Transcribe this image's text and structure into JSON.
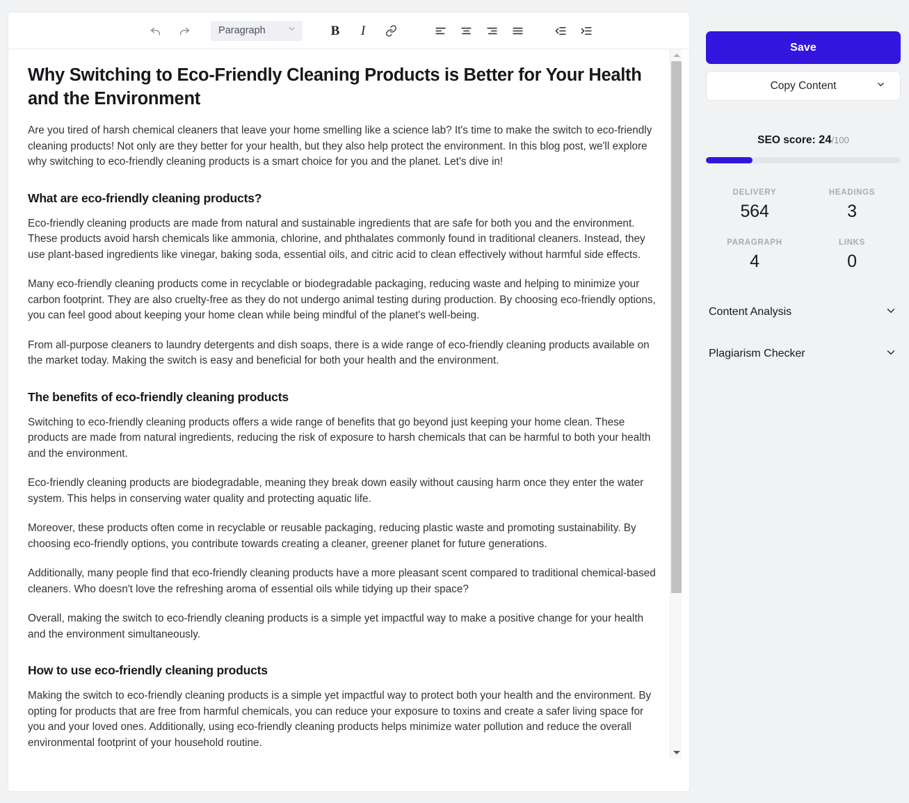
{
  "toolbar": {
    "undo_label": "undo-icon",
    "redo_label": "redo-icon",
    "block_format": "Paragraph",
    "bold_label": "B",
    "italic_label": "I",
    "link_label": "link-icon",
    "align_left_label": "align-left-icon",
    "align_center_label": "align-center-icon",
    "align_right_label": "align-right-icon",
    "align_justify_label": "align-justify-icon",
    "outdent_label": "outdent-icon",
    "indent_label": "indent-icon"
  },
  "document": {
    "title": "Why Switching to Eco-Friendly Cleaning Products is Better for Your Health and the Environment",
    "intro": "Are you tired of harsh chemical cleaners that leave your home smelling like a science lab? It's time to make the switch to eco-friendly cleaning products! Not only are they better for your health, but they also help protect the environment. In this blog post, we'll explore why switching to eco-friendly cleaning products is a smart choice for you and the planet. Let's dive in!",
    "h2_1": "What are eco-friendly cleaning products?",
    "p1": "Eco-friendly cleaning products are made from natural and sustainable ingredients that are safe for both you and the environment. These products avoid harsh chemicals like ammonia, chlorine, and phthalates commonly found in traditional cleaners. Instead, they use plant-based ingredients like vinegar, baking soda, essential oils, and citric acid to clean effectively without harmful side effects.",
    "p2": "Many eco-friendly cleaning products come in recyclable or biodegradable packaging, reducing waste and helping to minimize your carbon footprint. They are also cruelty-free as they do not undergo animal testing during production. By choosing eco-friendly options, you can feel good about keeping your home clean while being mindful of the planet's well-being.",
    "p3": "From all-purpose cleaners to laundry detergents and dish soaps, there is a wide range of eco-friendly cleaning products available on the market today. Making the switch is easy and beneficial for both your health and the environment.",
    "h2_2": "The benefits of eco-friendly cleaning products",
    "p4": "Switching to eco-friendly cleaning products offers a wide range of benefits that go beyond just keeping your home clean. These products are made from natural ingredients, reducing the risk of exposure to harsh chemicals that can be harmful to both your health and the environment.",
    "p5": "Eco-friendly cleaning products are biodegradable, meaning they break down easily without causing harm once they enter the water system. This helps in conserving water quality and protecting aquatic life.",
    "p6": "Moreover, these products often come in recyclable or reusable packaging, reducing plastic waste and promoting sustainability. By choosing eco-friendly options, you contribute towards creating a cleaner, greener planet for future generations.",
    "p7": "Additionally, many people find that eco-friendly cleaning products have a more pleasant scent compared to traditional chemical-based cleaners. Who doesn't love the refreshing aroma of essential oils while tidying up their space?",
    "p8": "Overall, making the switch to eco-friendly cleaning products is a simple yet impactful way to make a positive change for your health and the environment simultaneously.",
    "h2_3": "How to use eco-friendly cleaning products",
    "p9": "Making the switch to eco-friendly cleaning products is a simple yet impactful way to protect both your health and the environment. By opting for products that are free from harmful chemicals, you can reduce your exposure to toxins and create a safer living space for you and your loved ones. Additionally, using eco-friendly cleaning products helps minimize water pollution and reduce the overall environmental footprint of your household routine."
  },
  "sidebar": {
    "save_label": "Save",
    "copy_content_label": "Copy Content",
    "seo_label": "SEO score:",
    "seo_value": "24",
    "seo_max": "/100",
    "seo_percent": 24,
    "stats": [
      {
        "label": "DELIVERY",
        "value": "564"
      },
      {
        "label": "HEADINGS",
        "value": "3"
      },
      {
        "label": "PARAGRAPH",
        "value": "4"
      },
      {
        "label": "LINKS",
        "value": "0"
      }
    ],
    "accordions": [
      {
        "label": "Content Analysis"
      },
      {
        "label": "Plagiarism Checker"
      }
    ]
  },
  "colors": {
    "accent": "#3415dd",
    "page_background": "#f1f2f4",
    "panel_background": "#ffffff",
    "text_primary": "#16181c",
    "text_muted": "#a7abb3"
  }
}
